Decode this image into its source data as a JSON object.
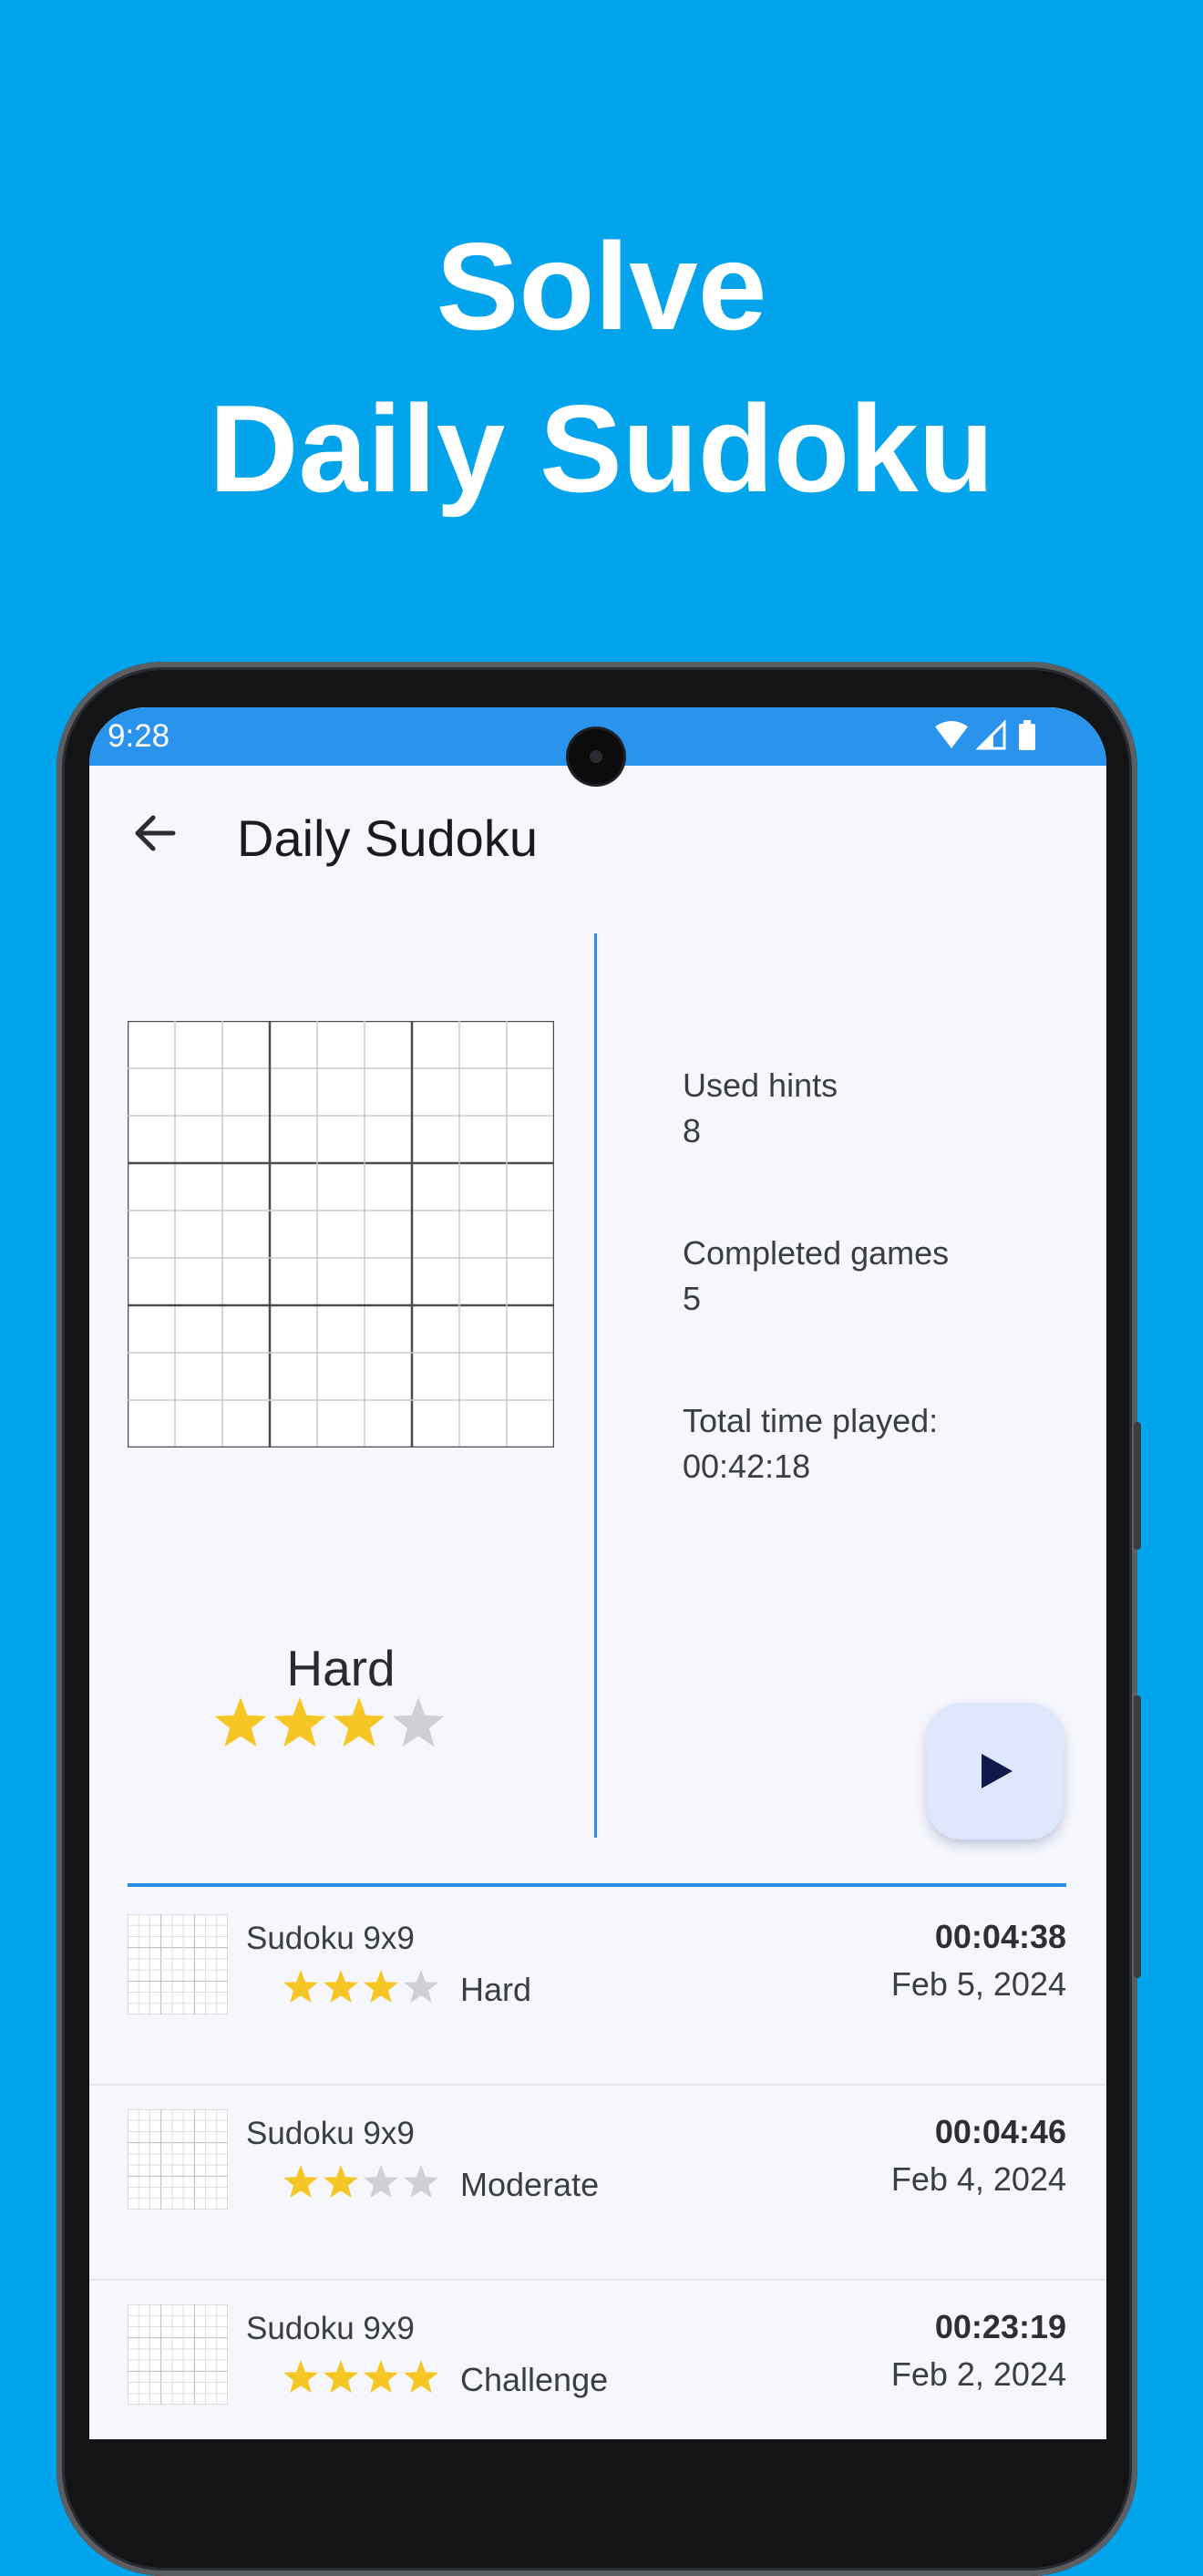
{
  "promo": {
    "line1": "Solve",
    "line2": "Daily Sudoku"
  },
  "status_bar": {
    "time": "9:28",
    "icons": [
      "wifi-icon",
      "cell-signal-icon",
      "battery-icon"
    ]
  },
  "app_bar": {
    "back_icon": "arrow-back-icon",
    "title": "Daily Sudoku"
  },
  "summary": {
    "difficulty": "Hard",
    "rating": 3,
    "max_rating": 4,
    "stats": [
      {
        "label": "Used hints",
        "value": "8"
      },
      {
        "label": "Completed games",
        "value": "5"
      },
      {
        "label": "Total time played:",
        "value": "00:42:18"
      }
    ],
    "play_icon": "play-icon"
  },
  "history": [
    {
      "name": "Sudoku 9x9",
      "rating": 3,
      "difficulty": "Hard",
      "time": "00:04:38",
      "date": "Feb 5, 2024"
    },
    {
      "name": "Sudoku 9x9",
      "rating": 2,
      "difficulty": "Moderate",
      "time": "00:04:46",
      "date": "Feb 4, 2024"
    },
    {
      "name": "Sudoku 9x9",
      "rating": 4,
      "difficulty": "Challenge",
      "time": "00:23:19",
      "date": "Feb 2, 2024"
    }
  ],
  "colors": {
    "background": "#03a4ec",
    "status_bar": "#2a94ec",
    "screen": "#f6f7fd",
    "accent": "#2a8fe6",
    "star_filled": "#f6c624",
    "star_empty": "#cfd0d4",
    "fab": "#dde6fb"
  }
}
